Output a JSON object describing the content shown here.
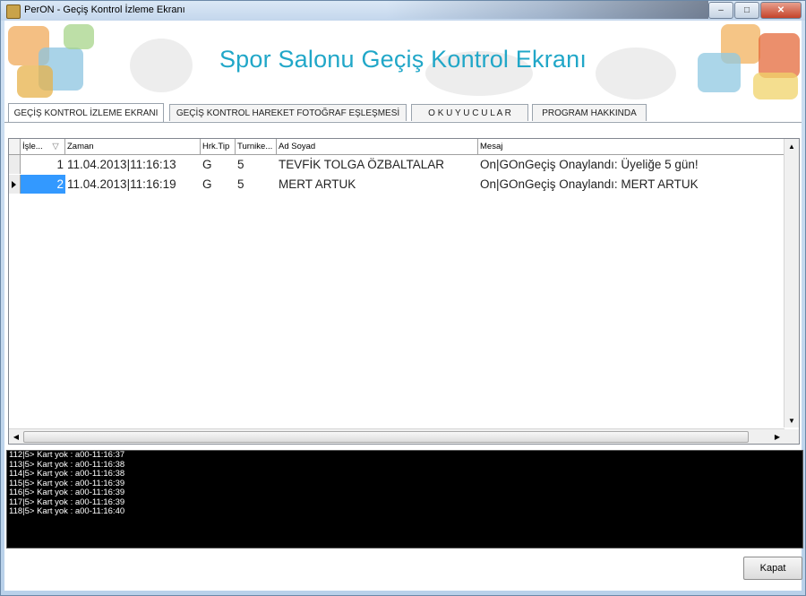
{
  "window": {
    "title": "PerON - Geçiş Kontrol İzleme Ekranı",
    "controls": {
      "minimize": "–",
      "maximize": "□",
      "close": "✕"
    }
  },
  "banner": {
    "title": "Spor Salonu Geçiş Kontrol Ekranı",
    "accent_color": "#21a7c8"
  },
  "tabs": [
    {
      "label": "GEÇİŞ KONTROL İZLEME EKRANI",
      "active": true
    },
    {
      "label": "GEÇİŞ KONTROL HAREKET FOTOĞRAF EŞLEŞMESİ",
      "active": false
    },
    {
      "label": "O K U Y U C U L A R",
      "active": false
    },
    {
      "label": "PROGRAM HAKKINDA",
      "active": false
    }
  ],
  "grid": {
    "columns": [
      "İşle...",
      "Zaman",
      "Hrk.Tip",
      "Turnike...",
      "Ad Soyad",
      "Mesaj"
    ],
    "sort_indicator": "▽",
    "rows": [
      {
        "id": "1",
        "time": "11.04.2013|11:16:13",
        "type": "G",
        "turnstile": "5",
        "name": "TEVFİK TOLGA ÖZBALTALAR",
        "message": "On|GOnGeçiş Onaylandı: Üyeliğe 5 gün!"
      },
      {
        "id": "2",
        "time": "11.04.2013|11:16:19",
        "type": "G",
        "turnstile": "5",
        "name": "MERT ARTUK",
        "message": "On|GOnGeçiş Onaylandı: MERT ARTUK"
      }
    ],
    "selected_row": 1,
    "selection_color": "#3399ff"
  },
  "log": [
    "112|5> Kart yok : a00-11:16:37",
    "113|5> Kart yok : a00-11:16:38",
    "114|5> Kart yok : a00-11:16:38",
    "115|5> Kart yok : a00-11:16:39",
    "116|5> Kart yok : a00-11:16:39",
    "117|5> Kart yok : a00-11:16:39",
    "118|5> Kart yok : a00-11:16:40"
  ],
  "buttons": {
    "close_label": "Kapat"
  }
}
